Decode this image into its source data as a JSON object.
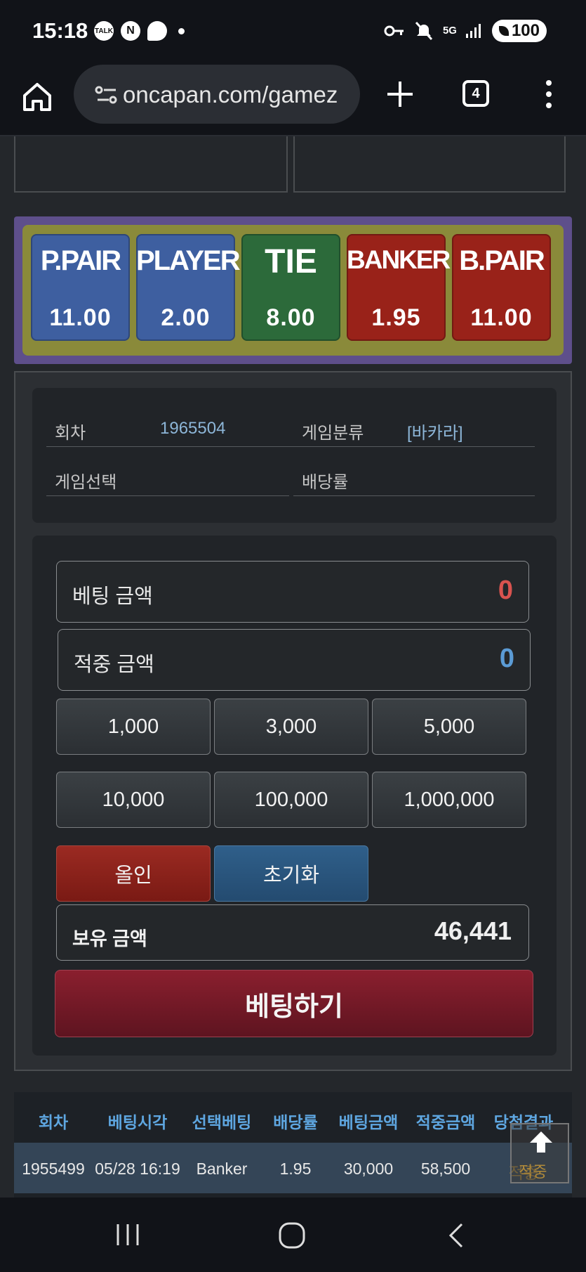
{
  "status_bar": {
    "time": "15:18",
    "notif_icons": [
      "talk-icon",
      "naver-icon",
      "chat-bubble-icon"
    ],
    "right_icons": [
      "key-icon",
      "mute-icon",
      "5g-icon",
      "signal-icon"
    ],
    "network": "5G",
    "battery": "100"
  },
  "browser": {
    "url": "oncapan.com/gamez",
    "tab_count": "4"
  },
  "odds": [
    {
      "name": "P.PAIR",
      "value": "11.00",
      "color": "#3e5fa0"
    },
    {
      "name": "PLAYER",
      "value": "2.00",
      "color": "#3e5fa0"
    },
    {
      "name": "TIE",
      "value": "8.00",
      "color": "#2c6a3a"
    },
    {
      "name": "BANKER",
      "value": "1.95",
      "color": "#992219"
    },
    {
      "name": "B.PAIR",
      "value": "11.00",
      "color": "#992219"
    }
  ],
  "info": {
    "round_label": "회차",
    "round_value": "1965504",
    "category_label": "게임분류",
    "category_value": "[바카라]",
    "selection_label": "게임선택",
    "odds_label": "배당률"
  },
  "bet_form": {
    "bet_amount_label": "베팅 금액",
    "bet_amount_value": "0",
    "win_amount_label": "적중 금액",
    "win_amount_value": "0",
    "amounts": [
      "1,000",
      "3,000",
      "5,000",
      "10,000",
      "100,000",
      "1,000,000"
    ],
    "allin_label": "올인",
    "reset_label": "초기화",
    "holding_label": "보유 금액",
    "holding_value": "46,441",
    "submit_label": "베팅하기"
  },
  "history": {
    "headers": [
      "회차",
      "베팅시각",
      "선택베팅",
      "배당률",
      "베팅금액",
      "적중금액",
      "당첨결과"
    ],
    "rows": [
      [
        "1955499",
        "05/28 16:19",
        "Banker",
        "1.95",
        "30,000",
        "58,500",
        "적중"
      ]
    ]
  },
  "to_top": {
    "label": "적중"
  },
  "colors": {
    "bet_amount": "#d9534f",
    "win_amount": "#5b9bd5",
    "header_text": "#5ea6e0"
  }
}
